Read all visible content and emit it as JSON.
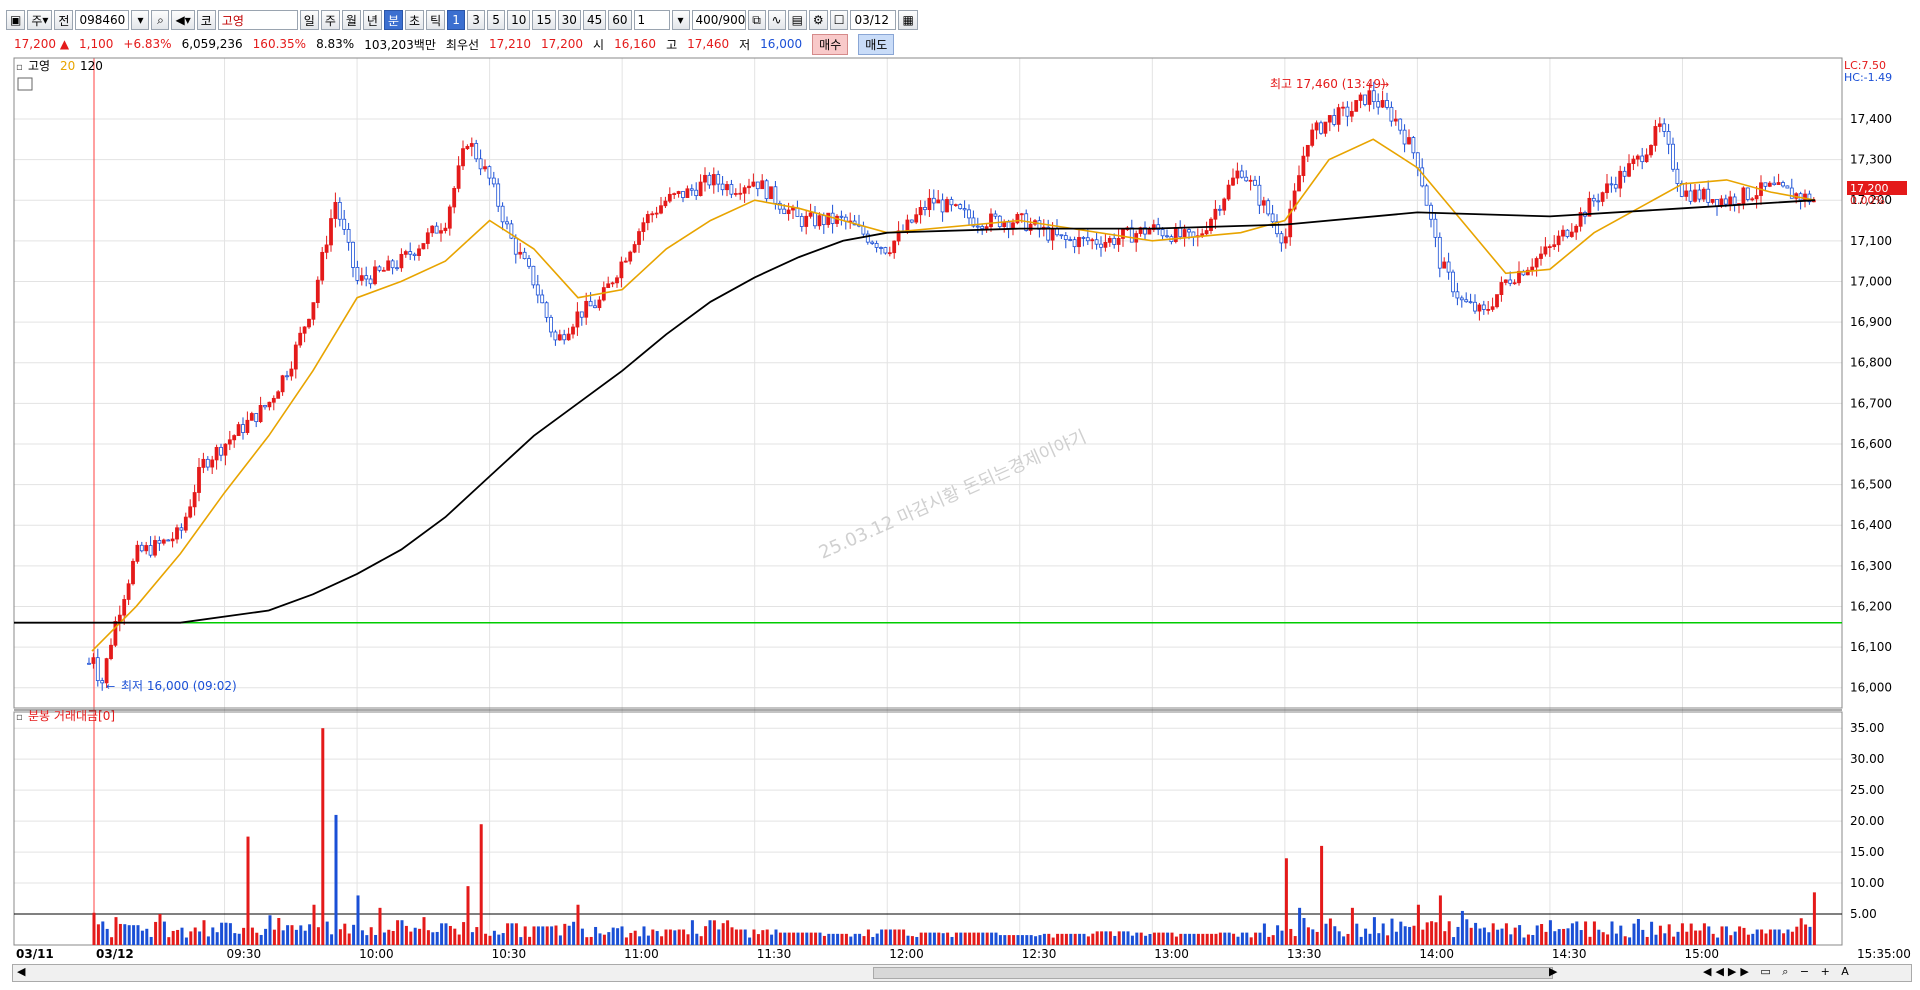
{
  "toolbar": {
    "code": "098460",
    "name": "고영",
    "sel_a": "주",
    "sel_b": "전",
    "market": "코",
    "periods": [
      "일",
      "주",
      "월",
      "년",
      "분",
      "초",
      "틱"
    ],
    "intervals": [
      "1",
      "3",
      "5",
      "10",
      "15",
      "30",
      "45",
      "60"
    ],
    "interval_input": "1",
    "count": "400",
    "count_max": "/900",
    "date": "03/12"
  },
  "quote": {
    "price": "17,200",
    "change": "1,100",
    "change_pct": "+6.83%",
    "volume": "6,059,236",
    "volume_pct": "160.35%",
    "turnover": "8.83%",
    "amount": "103,203백만",
    "best_label": "최우선",
    "ask": "17,210",
    "bid": "17,200",
    "open_label": "시",
    "open": "16,160",
    "high_label": "고",
    "high": "17,460",
    "low_label": "저",
    "low": "16,000",
    "buy_label": "매수",
    "sell_label": "매도"
  },
  "legend": {
    "name": "고영",
    "ma_short": "20",
    "ma_long": "120"
  },
  "indicators": {
    "lc": "LC:7.50",
    "hc": "HC:-1.49",
    "cur_price": "17,200",
    "cur_pct": "0.00%"
  },
  "annotations": {
    "high": "최고 17,460 (13:49)",
    "low": "최저 16,000 (09:02)",
    "watermark": "25.03.12 마감시황 돈되는경제이야기"
  },
  "volume_title": "분봉 거래대금[0]",
  "x_labels": [
    "03/11",
    "03/12",
    "09:30",
    "10:00",
    "10:30",
    "11:00",
    "11:30",
    "12:00",
    "12:30",
    "13:00",
    "13:30",
    "14:00",
    "14:30",
    "15:00",
    "15:35:00"
  ],
  "colors": {
    "up": "#e41a1a",
    "down": "#1a4fd6",
    "ma20": "#e8a400",
    "ma120": "#000000",
    "ref": "#00cc00"
  },
  "chart_data": [
    {
      "type": "line",
      "title": "",
      "ylim": [
        15950,
        17550
      ],
      "yticks": [
        16000,
        16100,
        16200,
        16300,
        16400,
        16500,
        16600,
        16700,
        16800,
        16900,
        17000,
        17100,
        17200,
        17300,
        17400
      ],
      "reference_line": 16160,
      "grid": true,
      "series": [
        {
          "name": "고영",
          "time": [
            "03/11 15:30",
            "09:00",
            "09:02",
            "09:05",
            "09:10",
            "09:15",
            "09:20",
            "09:25",
            "09:30",
            "09:35",
            "09:40",
            "09:45",
            "09:50",
            "09:55",
            "10:00",
            "10:05",
            "10:10",
            "10:15",
            "10:20",
            "10:25",
            "10:30",
            "10:35",
            "10:40",
            "10:45",
            "10:50",
            "10:55",
            "11:00",
            "11:05",
            "11:10",
            "11:15",
            "11:20",
            "11:25",
            "11:30",
            "11:40",
            "11:50",
            "12:00",
            "12:10",
            "12:20",
            "12:30",
            "12:40",
            "12:50",
            "13:00",
            "13:10",
            "13:20",
            "13:30",
            "13:35",
            "13:40",
            "13:45",
            "13:49",
            "13:55",
            "14:00",
            "14:05",
            "14:10",
            "14:15",
            "14:20",
            "14:30",
            "14:40",
            "14:50",
            "14:55",
            "15:00",
            "15:10",
            "15:20",
            "15:30"
          ],
          "values": [
            16060,
            16100,
            16000,
            16150,
            16330,
            16350,
            16380,
            16550,
            16600,
            16650,
            16700,
            16800,
            16950,
            17200,
            17000,
            17020,
            17050,
            17100,
            17150,
            17350,
            17250,
            17100,
            17000,
            16850,
            16920,
            16950,
            17050,
            17150,
            17200,
            17220,
            17250,
            17230,
            17250,
            17150,
            17150,
            17080,
            17200,
            17150,
            17150,
            17100,
            17100,
            17130,
            17100,
            17280,
            17100,
            17350,
            17400,
            17420,
            17460,
            17400,
            17300,
            17050,
            16950,
            16920,
            17000,
            17080,
            17200,
            17300,
            17380,
            17220,
            17200,
            17230,
            17200
          ]
        },
        {
          "name": "20",
          "time": [
            "09:00",
            "09:10",
            "09:20",
            "09:30",
            "09:40",
            "09:50",
            "10:00",
            "10:10",
            "10:20",
            "10:30",
            "10:40",
            "10:50",
            "11:00",
            "11:10",
            "11:20",
            "11:30",
            "11:40",
            "11:50",
            "12:00",
            "12:30",
            "13:00",
            "13:20",
            "13:30",
            "13:40",
            "13:50",
            "14:00",
            "14:10",
            "14:20",
            "14:30",
            "14:40",
            "14:50",
            "15:00",
            "15:10",
            "15:20",
            "15:30"
          ],
          "values": [
            16090,
            16200,
            16330,
            16480,
            16620,
            16780,
            16960,
            17000,
            17050,
            17150,
            17080,
            16960,
            16980,
            17080,
            17150,
            17200,
            17180,
            17150,
            17120,
            17150,
            17100,
            17120,
            17150,
            17300,
            17350,
            17280,
            17150,
            17020,
            17030,
            17120,
            17180,
            17240,
            17250,
            17220,
            17200
          ]
        },
        {
          "name": "120",
          "time": [
            "03/11 15:00",
            "09:05",
            "09:20",
            "09:40",
            "09:50",
            "10:00",
            "10:10",
            "10:20",
            "10:30",
            "10:40",
            "10:50",
            "11:00",
            "11:10",
            "11:20",
            "11:30",
            "11:40",
            "11:50",
            "12:00",
            "12:30",
            "13:00",
            "13:30",
            "14:00",
            "14:30",
            "15:00",
            "15:30"
          ],
          "values": [
            16160,
            16160,
            16160,
            16190,
            16230,
            16280,
            16340,
            16420,
            16520,
            16620,
            16700,
            16780,
            16870,
            16950,
            17010,
            17060,
            17100,
            17120,
            17130,
            17130,
            17140,
            17170,
            17160,
            17180,
            17200
          ]
        }
      ]
    },
    {
      "type": "bar",
      "title": "분봉 거래대금[0]",
      "ylim": [
        0,
        36
      ],
      "yticks": [
        5,
        10,
        15,
        20,
        25,
        30,
        35
      ],
      "reference_line": 5,
      "categories": [
        "09:00",
        "09:02",
        "09:05",
        "09:10",
        "09:15",
        "09:20",
        "09:25",
        "09:30",
        "09:35",
        "09:40",
        "09:45",
        "09:50",
        "09:52",
        "09:55",
        "10:00",
        "10:05",
        "10:10",
        "10:15",
        "10:20",
        "10:25",
        "10:28",
        "10:35",
        "10:40",
        "10:50",
        "11:00",
        "11:10",
        "11:20",
        "11:30",
        "11:40",
        "11:50",
        "12:00",
        "12:10",
        "12:20",
        "12:30",
        "12:40",
        "12:50",
        "13:00",
        "13:10",
        "13:20",
        "13:30",
        "13:33",
        "13:38",
        "13:45",
        "13:50",
        "14:00",
        "14:05",
        "14:10",
        "14:20",
        "14:30",
        "14:40",
        "14:50",
        "15:00",
        "15:10",
        "15:20",
        "15:30"
      ],
      "values": [
        5.2,
        3.8,
        4.5,
        3.2,
        5.0,
        2.8,
        4.0,
        3.6,
        17.5,
        4.8,
        3.2,
        6.5,
        35.0,
        21.0,
        8.0,
        6.0,
        4.0,
        4.5,
        3.5,
        9.5,
        19.5,
        3.5,
        3.0,
        6.5,
        3.0,
        2.5,
        4.0,
        2.5,
        2.0,
        1.8,
        2.5,
        2.0,
        2.0,
        1.6,
        1.8,
        2.2,
        2.0,
        1.8,
        2.0,
        14.0,
        6.0,
        16.0,
        6.0,
        4.5,
        6.5,
        8.0,
        5.5,
        3.5,
        4.0,
        3.8,
        4.2,
        3.5,
        3.0,
        2.5,
        8.5
      ],
      "direction": [
        "up",
        "down",
        "up",
        "down",
        "up",
        "down",
        "up",
        "down",
        "up",
        "down",
        "up",
        "up",
        "up",
        "down",
        "down",
        "up",
        "down",
        "up",
        "down",
        "up",
        "up",
        "down",
        "up",
        "up",
        "down",
        "up",
        "down",
        "up",
        "down",
        "up",
        "up",
        "down",
        "up",
        "down",
        "up",
        "down",
        "up",
        "up",
        "down",
        "up",
        "down",
        "up",
        "up",
        "down",
        "up",
        "up",
        "down",
        "up",
        "down",
        "up",
        "down",
        "up",
        "down",
        "up",
        "up"
      ]
    }
  ]
}
